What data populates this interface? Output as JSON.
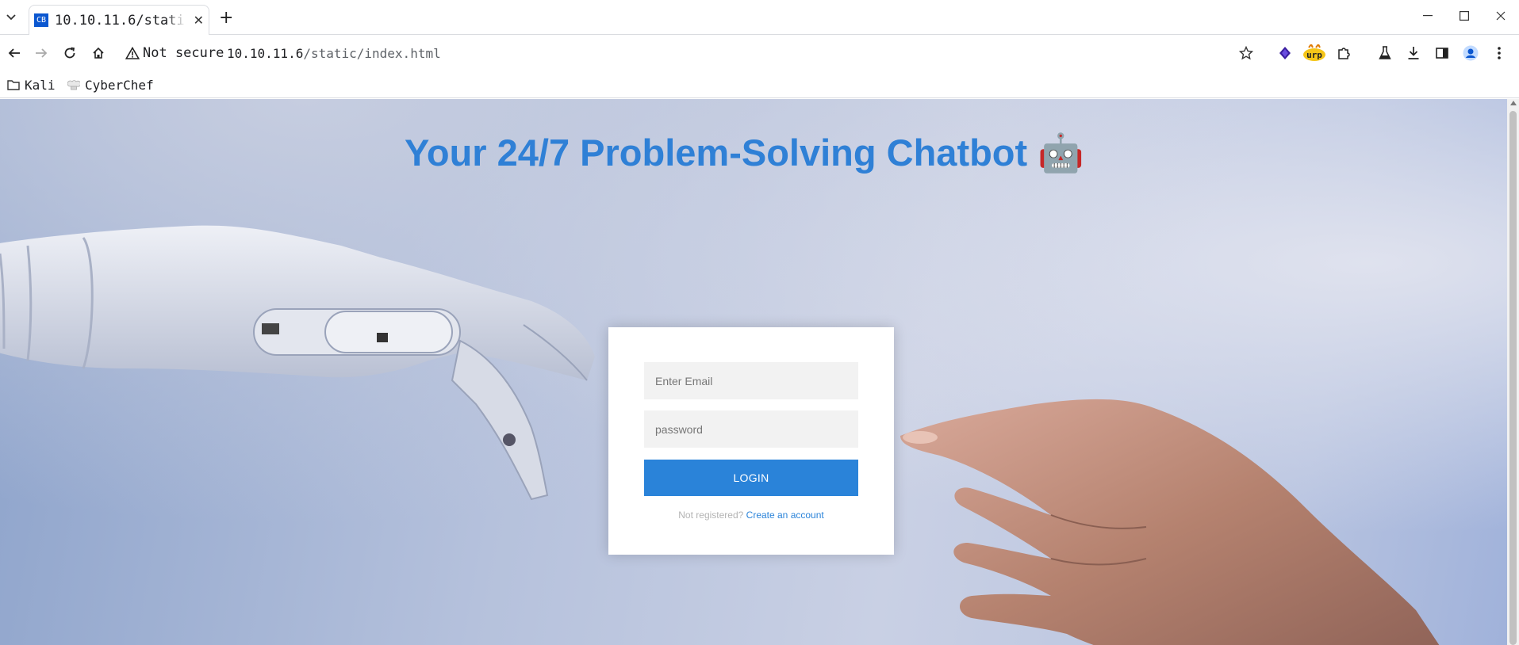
{
  "browser": {
    "tab": {
      "favicon_text": "CB",
      "title": "10.10.11.6/static/index.html",
      "close_glyph": "✕"
    },
    "new_tab_glyph": "+",
    "security_label": "Not secure",
    "url_host": "10.10.11.6",
    "url_path": "/static/index.html",
    "bookmarks": [
      {
        "label": "Kali",
        "icon": "folder-icon"
      },
      {
        "label": "CyberChef",
        "icon": "chef-hat-icon"
      }
    ],
    "extension_label": "urp"
  },
  "page": {
    "headline": "Your 24/7 Problem-Solving Chatbot",
    "headline_emoji": "🤖",
    "login": {
      "email_placeholder": "Enter Email",
      "password_placeholder": "password",
      "button_label": "LOGIN",
      "register_prompt": "Not registered?",
      "register_link": "Create an account"
    }
  },
  "colors": {
    "accent": "#2a83d9",
    "headline": "#2f80d6",
    "background": "#b5c1dc"
  }
}
